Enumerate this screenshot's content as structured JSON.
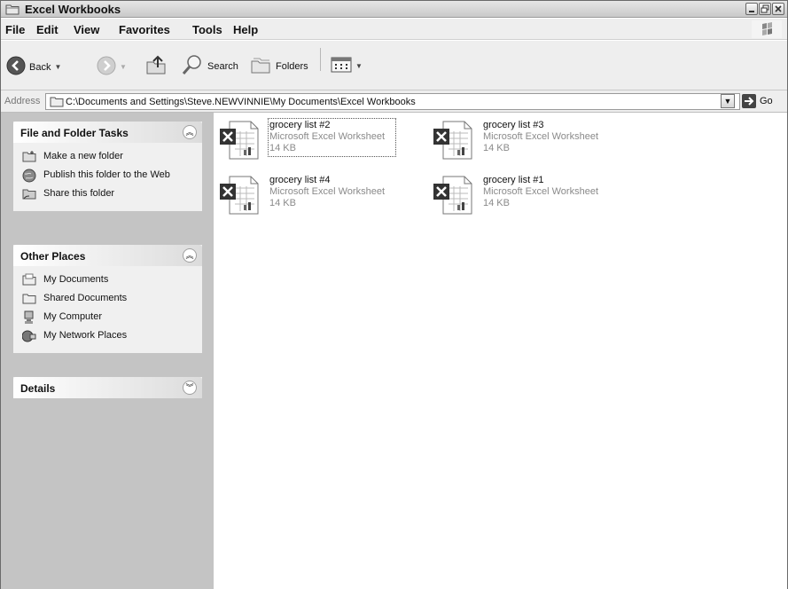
{
  "window": {
    "title": "Excel Workbooks"
  },
  "menu": [
    "File",
    "Edit",
    "View",
    "Favorites",
    "Tools",
    "Help"
  ],
  "toolbar": {
    "back_label": "Back",
    "search_label": "Search",
    "folders_label": "Folders"
  },
  "address": {
    "label": "Address",
    "path": "C:\\Documents and Settings\\Steve.NEWVINNIE\\My Documents\\Excel Workbooks",
    "go_label": "Go"
  },
  "taskpane": {
    "file_tasks": {
      "title": "File and Folder Tasks",
      "items": [
        "Make a new folder",
        "Publish this folder to the Web",
        "Share this folder"
      ]
    },
    "other_places": {
      "title": "Other Places",
      "items": [
        "My Documents",
        "Shared Documents",
        "My Computer",
        "My Network Places"
      ]
    },
    "details": {
      "title": "Details"
    }
  },
  "files": [
    {
      "name": "grocery list #2",
      "type": "Microsoft Excel Worksheet",
      "size": "14 KB"
    },
    {
      "name": "grocery list #3",
      "type": "Microsoft Excel Worksheet",
      "size": "14 KB"
    },
    {
      "name": "grocery list #4",
      "type": "Microsoft Excel Worksheet",
      "size": "14 KB"
    },
    {
      "name": "grocery list #1",
      "type": "Microsoft Excel Worksheet",
      "size": "14 KB"
    }
  ]
}
